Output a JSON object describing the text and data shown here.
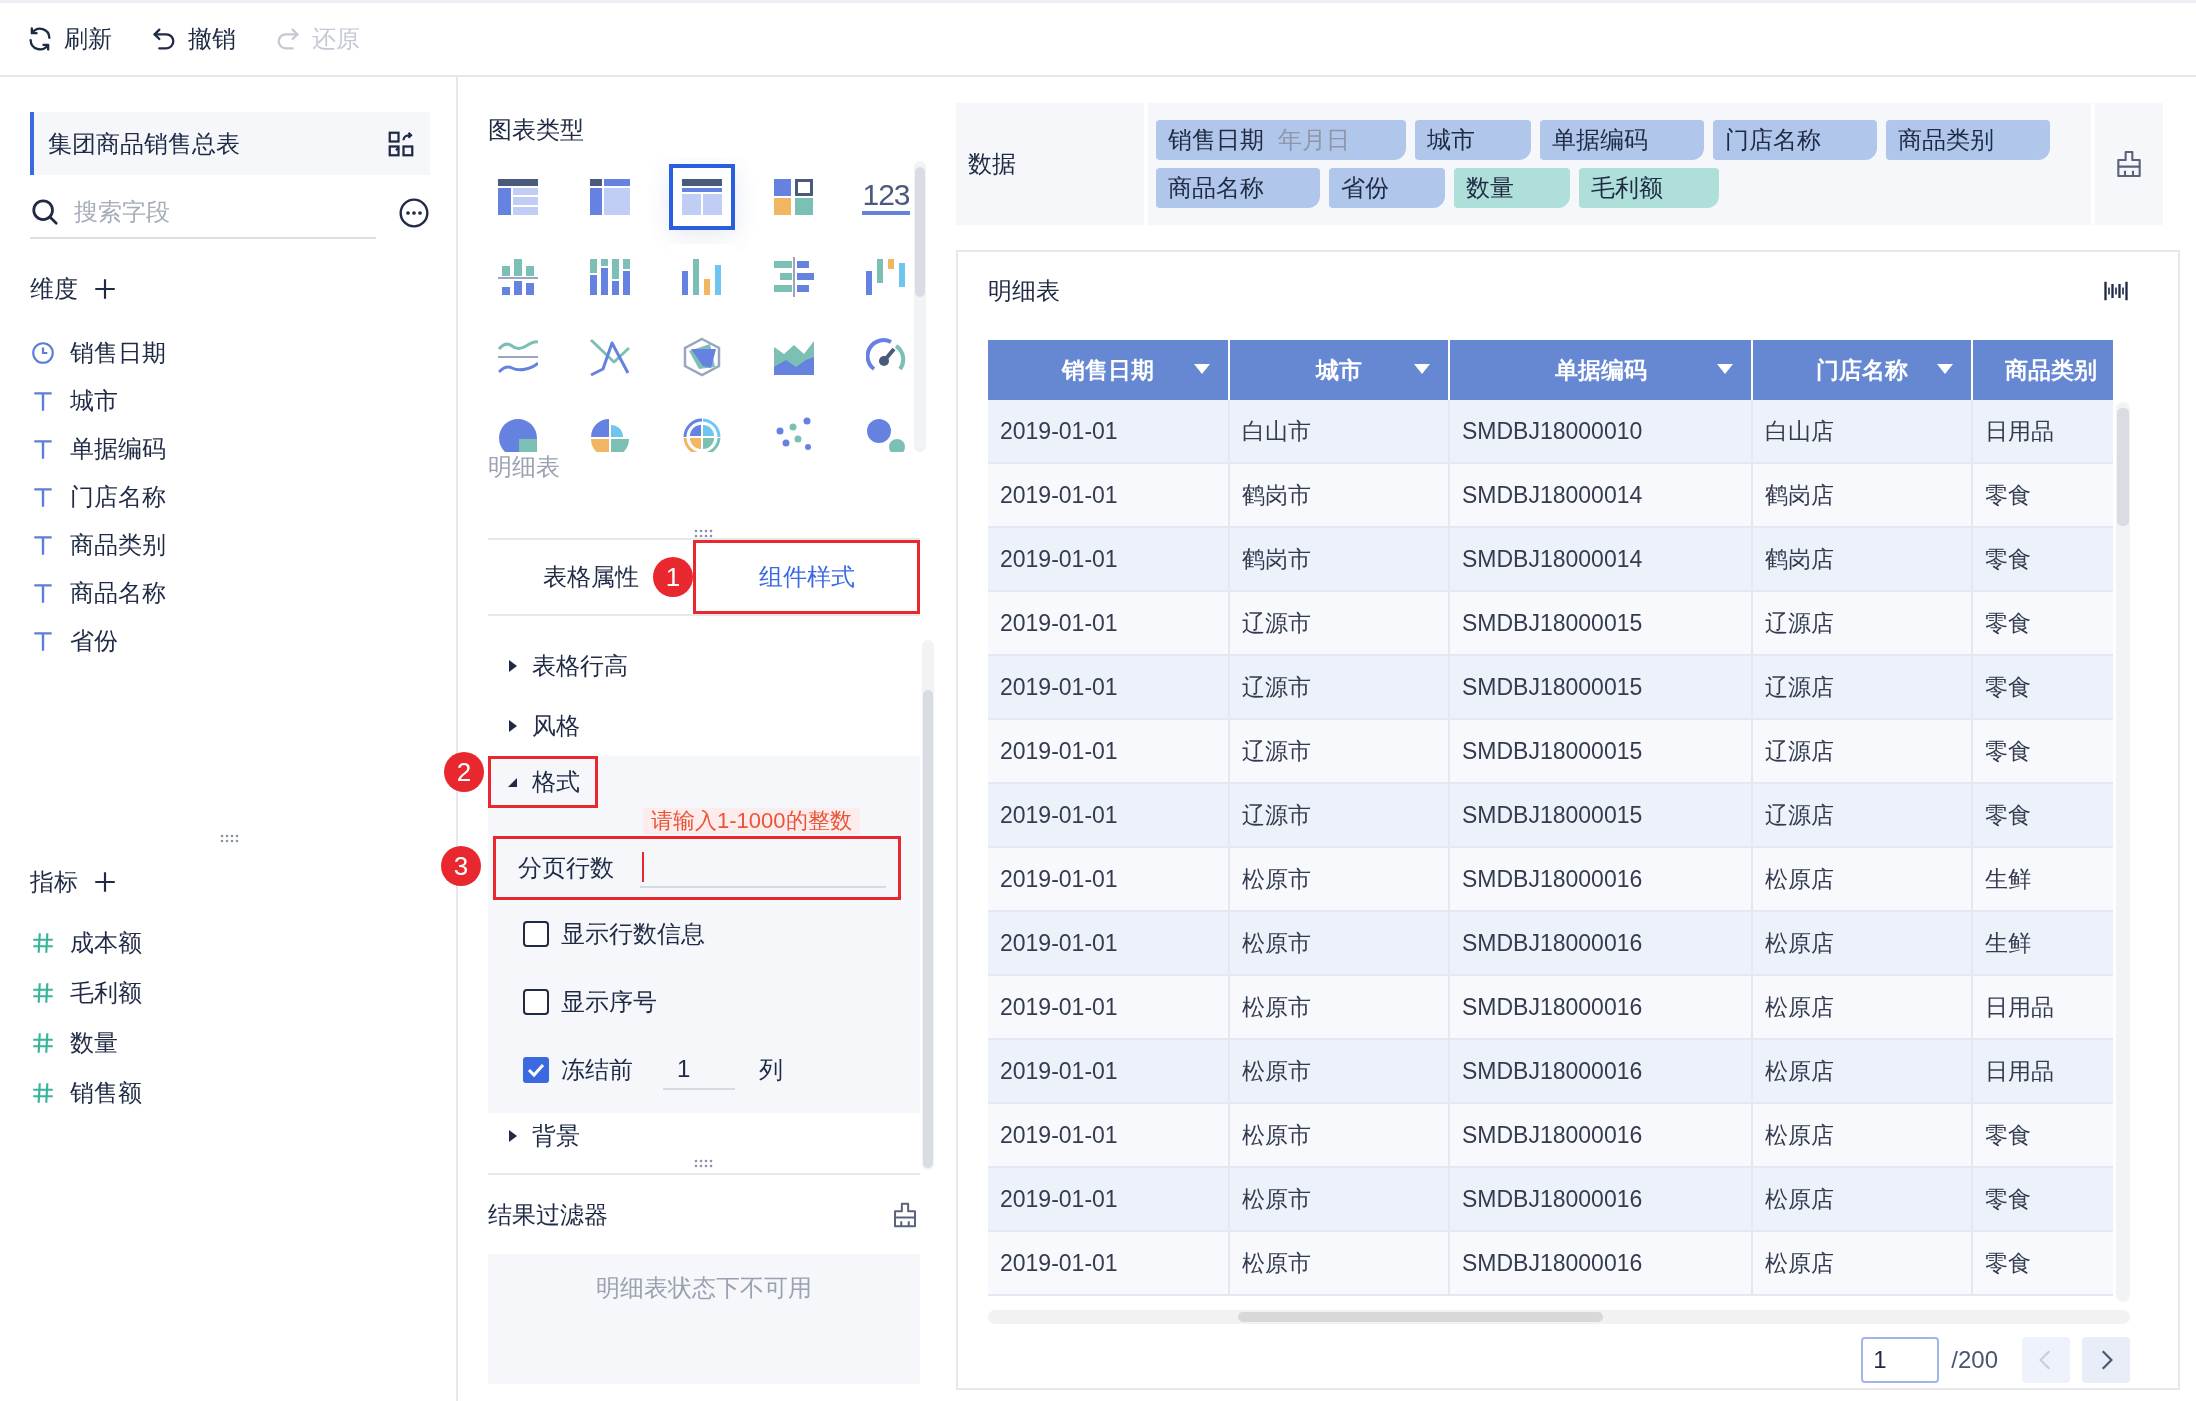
{
  "toolbar": [
    {
      "kind": "refresh",
      "label": "刷新",
      "disabled": false
    },
    {
      "kind": "undo",
      "label": "撤销",
      "disabled": false
    },
    {
      "kind": "redo",
      "label": "还原",
      "disabled": true
    }
  ],
  "dataset": {
    "title": "集团商品销售总表"
  },
  "field_search": {
    "placeholder": "搜索字段"
  },
  "dimensions": {
    "title": "维度",
    "fields": [
      {
        "name": "销售日期",
        "kind": "date"
      },
      {
        "name": "城市",
        "kind": "text"
      },
      {
        "name": "单据编码",
        "kind": "text"
      },
      {
        "name": "门店名称",
        "kind": "text"
      },
      {
        "name": "商品类别",
        "kind": "text"
      },
      {
        "name": "商品名称",
        "kind": "text"
      },
      {
        "name": "省份",
        "kind": "text"
      }
    ]
  },
  "measures": {
    "title": "指标",
    "fields": [
      {
        "name": "成本额",
        "kind": "number"
      },
      {
        "name": "毛利额",
        "kind": "number"
      },
      {
        "name": "数量",
        "kind": "number"
      },
      {
        "name": "销售额",
        "kind": "number"
      }
    ]
  },
  "chart_types": {
    "title": "图表类型",
    "current": "明细表",
    "types": [
      {
        "kind": "group-table",
        "selected": false
      },
      {
        "kind": "crosstab",
        "selected": false
      },
      {
        "kind": "detail-table",
        "selected": true
      },
      {
        "kind": "kpi",
        "selected": false
      },
      {
        "kind": "number",
        "label": "123",
        "selected": false
      },
      {
        "kind": "split-bar",
        "selected": false
      },
      {
        "kind": "stacked-bar",
        "selected": false
      },
      {
        "kind": "bar",
        "selected": false
      },
      {
        "kind": "mirror-bar",
        "selected": false
      },
      {
        "kind": "range-bar",
        "selected": false
      },
      {
        "kind": "wave",
        "selected": false
      },
      {
        "kind": "cross-line",
        "selected": false
      },
      {
        "kind": "radar",
        "selected": false
      },
      {
        "kind": "area",
        "selected": false
      },
      {
        "kind": "gauge",
        "selected": false
      },
      {
        "kind": "pie",
        "selected": false
      },
      {
        "kind": "quarter-pie",
        "selected": false
      },
      {
        "kind": "rose",
        "selected": false
      },
      {
        "kind": "scatter",
        "selected": false
      },
      {
        "kind": "bubble",
        "selected": false
      }
    ]
  },
  "property_tabs": [
    {
      "label": "表格属性",
      "selected": false
    },
    {
      "label": "组件样式",
      "selected": true,
      "annotation": "1"
    }
  ],
  "style_sections": [
    {
      "label": "表格行高",
      "expanded": false
    },
    {
      "label": "风格",
      "expanded": false
    },
    {
      "label": "格式",
      "expanded": true,
      "annotation": "2"
    },
    {
      "label": "背景",
      "expanded": false
    }
  ],
  "format": {
    "page_rows": {
      "label": "分页行数",
      "focused": true,
      "error": "请输入1-1000的整数",
      "annotation": "3"
    },
    "options": [
      {
        "label": "显示行数信息",
        "checked": false
      },
      {
        "label": "显示序号",
        "checked": false
      },
      {
        "label": "冻结前",
        "checked": true,
        "value": "1",
        "suffix": "列"
      }
    ]
  },
  "result_filter": {
    "title": "结果过滤器",
    "message": "明细表状态下不可用"
  },
  "data_fields": {
    "label": "数据",
    "tags": [
      {
        "name": "销售日期",
        "sub": "年月日",
        "kind": "dimension"
      },
      {
        "name": "城市",
        "kind": "dimension"
      },
      {
        "name": "单据编码",
        "kind": "dimension"
      },
      {
        "name": "门店名称",
        "kind": "dimension"
      },
      {
        "name": "商品类别",
        "kind": "dimension"
      },
      {
        "name": "商品名称",
        "kind": "dimension"
      },
      {
        "name": "省份",
        "kind": "dimension"
      },
      {
        "name": "数量",
        "kind": "measure"
      },
      {
        "name": "毛利额",
        "kind": "measure"
      }
    ]
  },
  "table": {
    "title": "明细表",
    "columns": [
      {
        "label": "销售日期",
        "menu": true
      },
      {
        "label": "城市",
        "menu": true
      },
      {
        "label": "单据编码",
        "menu": true
      },
      {
        "label": "门店名称",
        "menu": true
      },
      {
        "label": "商品类别",
        "menu": false
      }
    ],
    "rows": [
      [
        "2019-01-01",
        "白山市",
        "SMDBJ18000010",
        "白山店",
        "日用品"
      ],
      [
        "2019-01-01",
        "鹤岗市",
        "SMDBJ18000014",
        "鹤岗店",
        "零食"
      ],
      [
        "2019-01-01",
        "鹤岗市",
        "SMDBJ18000014",
        "鹤岗店",
        "零食"
      ],
      [
        "2019-01-01",
        "辽源市",
        "SMDBJ18000015",
        "辽源店",
        "零食"
      ],
      [
        "2019-01-01",
        "辽源市",
        "SMDBJ18000015",
        "辽源店",
        "零食"
      ],
      [
        "2019-01-01",
        "辽源市",
        "SMDBJ18000015",
        "辽源店",
        "零食"
      ],
      [
        "2019-01-01",
        "辽源市",
        "SMDBJ18000015",
        "辽源店",
        "零食"
      ],
      [
        "2019-01-01",
        "松原市",
        "SMDBJ18000016",
        "松原店",
        "生鲜"
      ],
      [
        "2019-01-01",
        "松原市",
        "SMDBJ18000016",
        "松原店",
        "生鲜"
      ],
      [
        "2019-01-01",
        "松原市",
        "SMDBJ18000016",
        "松原店",
        "日用品"
      ],
      [
        "2019-01-01",
        "松原市",
        "SMDBJ18000016",
        "松原店",
        "日用品"
      ],
      [
        "2019-01-01",
        "松原市",
        "SMDBJ18000016",
        "松原店",
        "零食"
      ],
      [
        "2019-01-01",
        "松原市",
        "SMDBJ18000016",
        "松原店",
        "零食"
      ],
      [
        "2019-01-01",
        "松原市",
        "SMDBJ18000016",
        "松原店",
        "零食"
      ]
    ]
  },
  "pagination": {
    "page": "1",
    "total": "/200",
    "prev": {
      "disabled": true
    },
    "next": {
      "disabled": false
    }
  }
}
